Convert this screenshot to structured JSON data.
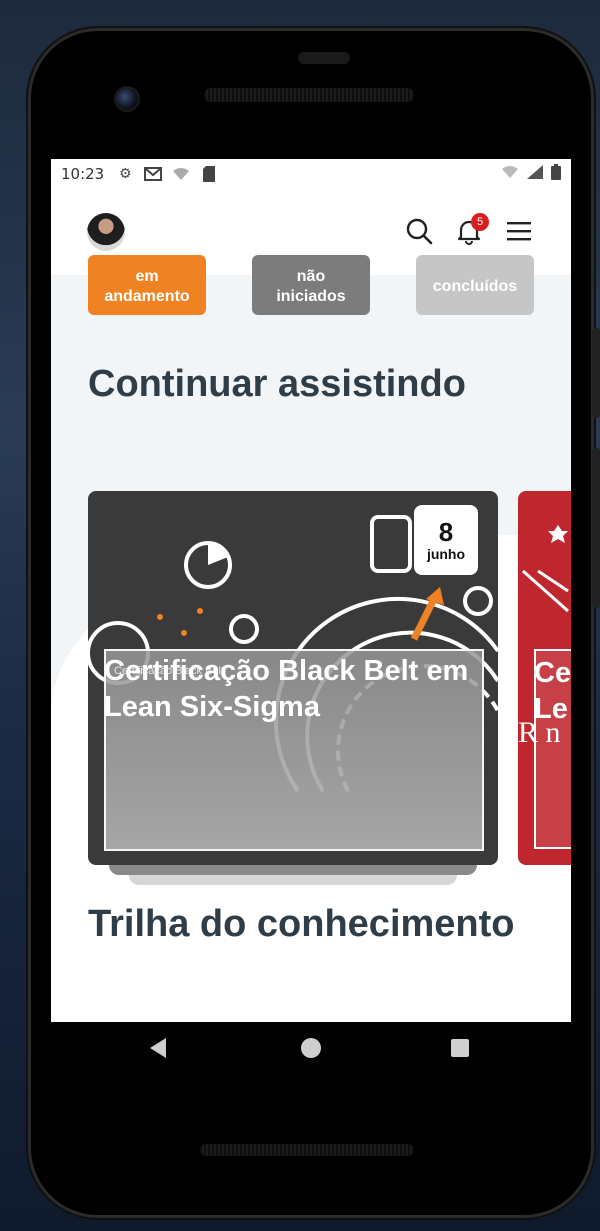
{
  "status_bar": {
    "time": "10:23",
    "left_icons": [
      "gear-icon",
      "gmail-icon",
      "wifi-question-icon",
      "sd-card-icon"
    ],
    "right_icons": [
      "wifi-off-icon",
      "signal-icon",
      "battery-icon"
    ]
  },
  "app_bar": {
    "notification_count": "5"
  },
  "filters": [
    {
      "line1": "em",
      "line2": "andamento",
      "color": "#ef8324"
    },
    {
      "line1": "não",
      "line2": "iniciados",
      "color": "#7c7c7c"
    },
    {
      "line1": "",
      "line2": "concluídos",
      "color": "#c6c6c6"
    }
  ],
  "sections": {
    "continue_title": "Continuar assistindo",
    "trail_title": "Trilha do conhecimento"
  },
  "cards": [
    {
      "title": "Certificação Black Belt em Lean Six-Sigma",
      "subtitle": "Certificação Black Belt",
      "day": "8",
      "month": "junho"
    },
    {
      "title": "Ce Le",
      "fragment": "R n"
    }
  ],
  "colors": {
    "accent_orange": "#ef8324",
    "title_dark": "#2e3d47",
    "card_red": "#c0262e",
    "badge_red": "#d81e1e"
  }
}
